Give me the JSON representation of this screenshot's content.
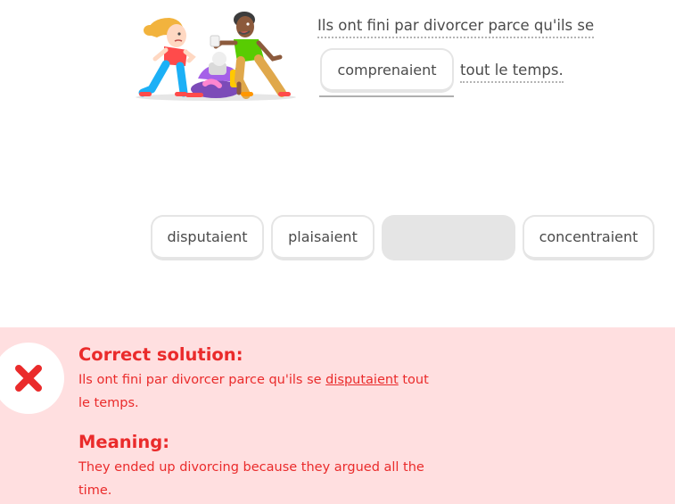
{
  "exercise": {
    "sentence_line1": "Ils ont fini par divorcer parce qu'ils se",
    "selected_answer": "comprenaient",
    "sentence_end": "tout le temps."
  },
  "word_bank": [
    {
      "label": "disputaient",
      "used": false
    },
    {
      "label": "plaisaient",
      "used": false
    },
    {
      "label": "",
      "used": true
    },
    {
      "label": "concentraient",
      "used": false
    }
  ],
  "feedback": {
    "status": "incorrect",
    "correct_heading": "Correct solution:",
    "correct_prefix": "Ils ont fini par divorcer parce qu'ils se",
    "correct_word": "disputaient",
    "correct_suffix": "tout le temps.",
    "meaning_heading": "Meaning:",
    "meaning_text": "They ended up divorcing because they argued all the time.",
    "colors": {
      "background": "#ffdfe0",
      "text": "#ea2b2b",
      "icon": "#ea2b2b"
    }
  }
}
